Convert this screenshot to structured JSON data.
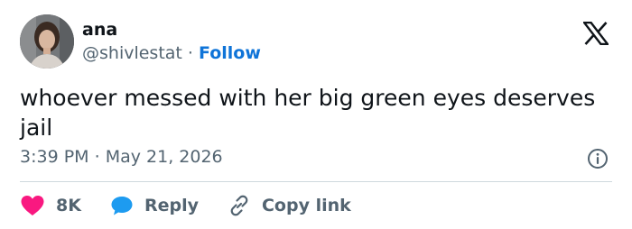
{
  "user": {
    "name": "ana",
    "handle": "@shivlestat",
    "separator": "·",
    "follow_label": "Follow"
  },
  "tweet": {
    "text": "whoever messed with her big green eyes deserves jail",
    "time": "3:39 PM",
    "date_separator": "·",
    "date": "May 21, 2026"
  },
  "actions": {
    "likes": "8K",
    "reply_label": "Reply",
    "copy_link_label": "Copy link"
  },
  "icons": {
    "logo": "x-logo-icon",
    "info": "info-icon",
    "like": "heart-icon",
    "reply": "speech-bubble-icon",
    "copy": "link-icon"
  },
  "colors": {
    "accent": "#0f74d8",
    "like": "#f91880",
    "reply": "#1d9bf0",
    "secondary_text": "#536471"
  }
}
